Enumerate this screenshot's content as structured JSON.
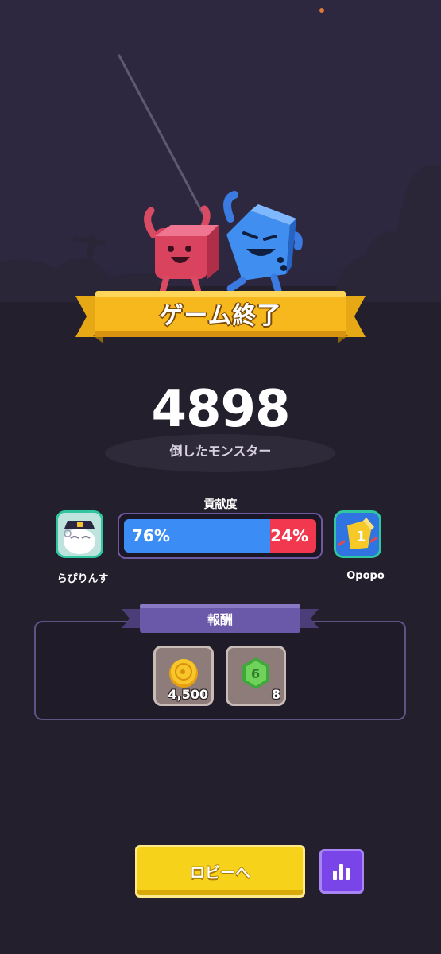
{
  "banner": {
    "title": "ゲーム終了"
  },
  "score": {
    "value": "4898",
    "label": "倒したモンスター"
  },
  "contribution": {
    "title": "貢献度",
    "left_player": {
      "name": "らぴりんす",
      "percent": 76,
      "percent_label": "76%",
      "color": "#3b8cf4"
    },
    "right_player": {
      "name": "Opopo",
      "percent": 24,
      "percent_label": "24%",
      "color": "#f2384f"
    }
  },
  "rewards": {
    "title": "報酬",
    "items": [
      {
        "icon": "gold-coin-icon",
        "count": "4,500"
      },
      {
        "icon": "green-gem-icon",
        "count": "8"
      }
    ]
  },
  "buttons": {
    "lobby_label": "ロビーへ",
    "stats_icon": "bar-chart-icon"
  }
}
